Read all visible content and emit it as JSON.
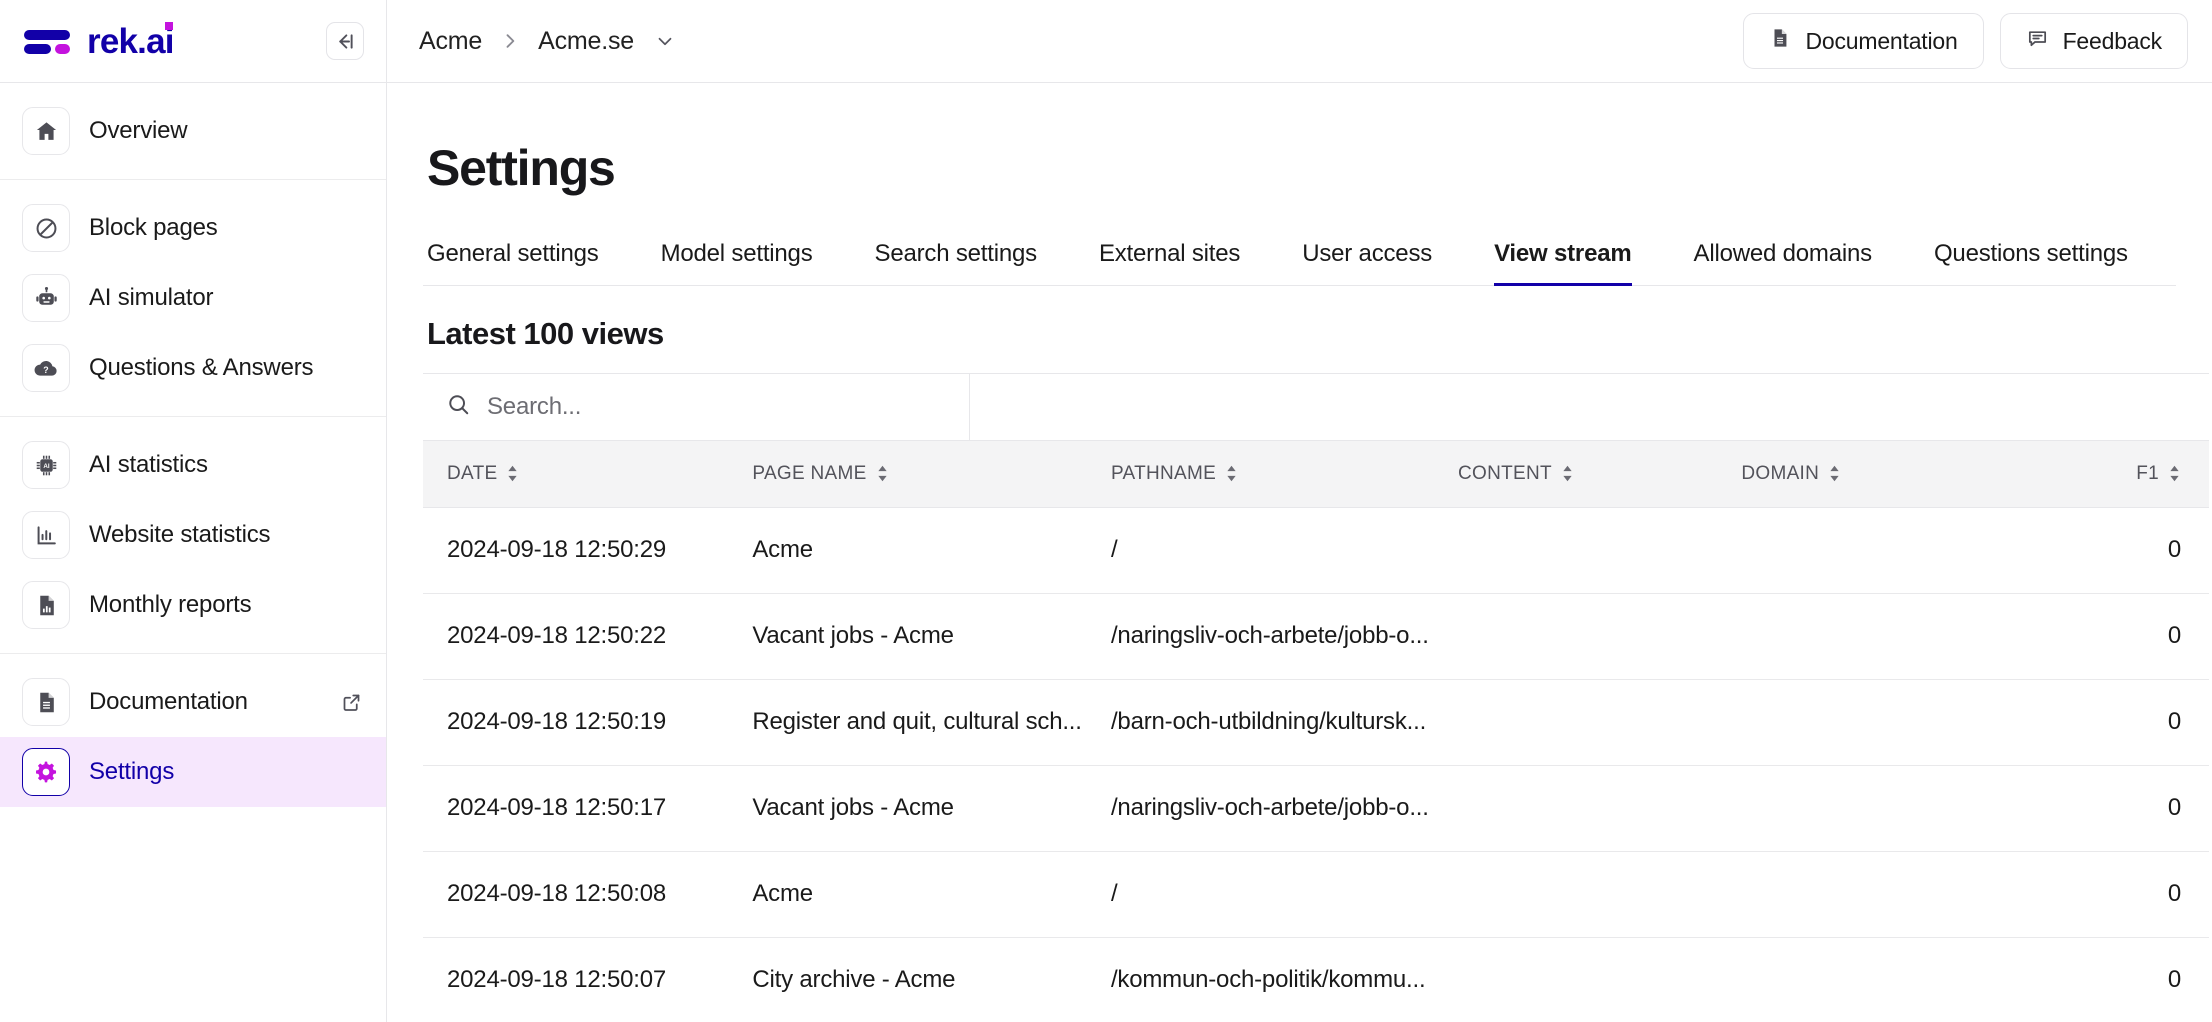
{
  "brand": {
    "name": "rek.ai",
    "logo_icon": "rekai-logo-mark"
  },
  "sidebar": {
    "collapse_icon": "collapse-sidebar-icon",
    "groups": [
      {
        "items": [
          {
            "label": "Overview",
            "icon": "home-icon",
            "active": false
          }
        ]
      },
      {
        "items": [
          {
            "label": "Block pages",
            "icon": "block-icon",
            "active": false
          },
          {
            "label": "AI simulator",
            "icon": "robot-icon",
            "active": false
          },
          {
            "label": "Questions & Answers",
            "icon": "cloud-question-icon",
            "active": false
          }
        ]
      },
      {
        "items": [
          {
            "label": "AI statistics",
            "icon": "ai-chip-icon",
            "active": false
          },
          {
            "label": "Website statistics",
            "icon": "bar-chart-icon",
            "active": false
          },
          {
            "label": "Monthly reports",
            "icon": "report-document-icon",
            "active": false
          }
        ]
      },
      {
        "items": [
          {
            "label": "Documentation",
            "icon": "document-icon",
            "active": false,
            "external": true
          },
          {
            "label": "Settings",
            "icon": "gear-icon",
            "active": true
          }
        ]
      }
    ]
  },
  "topbar": {
    "breadcrumb": [
      "Acme",
      "Acme.se"
    ],
    "breadcrumb_separator": "chevron-right-icon",
    "breadcrumb_caret_icon": "chevron-down-icon",
    "documentation_label": "Documentation",
    "documentation_icon": "document-icon",
    "feedback_label": "Feedback",
    "feedback_icon": "chat-bubble-icon"
  },
  "page": {
    "title": "Settings",
    "tabs": [
      {
        "label": "General settings",
        "active": false
      },
      {
        "label": "Model settings",
        "active": false
      },
      {
        "label": "Search settings",
        "active": false
      },
      {
        "label": "External sites",
        "active": false
      },
      {
        "label": "User access",
        "active": false
      },
      {
        "label": "View stream",
        "active": true
      },
      {
        "label": "Allowed domains",
        "active": false
      },
      {
        "label": "Questions settings",
        "active": false
      }
    ],
    "section_title": "Latest 100 views"
  },
  "search": {
    "placeholder": "Search...",
    "value": "",
    "icon": "search-icon"
  },
  "table": {
    "columns": [
      {
        "key": "date",
        "label": "DATE",
        "sortable": true,
        "align": "left"
      },
      {
        "key": "page_name",
        "label": "PAGE NAME",
        "sortable": true,
        "align": "left"
      },
      {
        "key": "pathname",
        "label": "PATHNAME",
        "sortable": true,
        "align": "left"
      },
      {
        "key": "content",
        "label": "CONTENT",
        "sortable": true,
        "align": "left"
      },
      {
        "key": "domain",
        "label": "DOMAIN",
        "sortable": true,
        "align": "left"
      },
      {
        "key": "f1",
        "label": "F1",
        "sortable": true,
        "align": "right"
      }
    ],
    "rows": [
      {
        "date": "2024-09-18 12:50:29",
        "page_name": "Acme",
        "pathname": "/",
        "content": "",
        "domain": "",
        "f1": "0"
      },
      {
        "date": "2024-09-18 12:50:22",
        "page_name": "Vacant jobs - Acme",
        "pathname": "/naringsliv-och-arbete/jobb-o...",
        "content": "",
        "domain": "",
        "f1": "0"
      },
      {
        "date": "2024-09-18 12:50:19",
        "page_name": "Register and quit, cultural sch...",
        "pathname": "/barn-och-utbildning/kultursk...",
        "content": "",
        "domain": "",
        "f1": "0"
      },
      {
        "date": "2024-09-18 12:50:17",
        "page_name": "Vacant jobs - Acme",
        "pathname": "/naringsliv-och-arbete/jobb-o...",
        "content": "",
        "domain": "",
        "f1": "0"
      },
      {
        "date": "2024-09-18 12:50:08",
        "page_name": "Acme",
        "pathname": "/",
        "content": "",
        "domain": "",
        "f1": "0"
      },
      {
        "date": "2024-09-18 12:50:07",
        "page_name": "City archive - Acme",
        "pathname": "/kommun-och-politik/kommu...",
        "content": "",
        "domain": "",
        "f1": "0"
      }
    ]
  },
  "colors": {
    "brand_blue": "#1200a8",
    "brand_magenta": "#c413de",
    "active_nav_bg": "#f6e7fd",
    "table_header_bg": "#f4f4f5",
    "border": "#e7e7ea"
  }
}
